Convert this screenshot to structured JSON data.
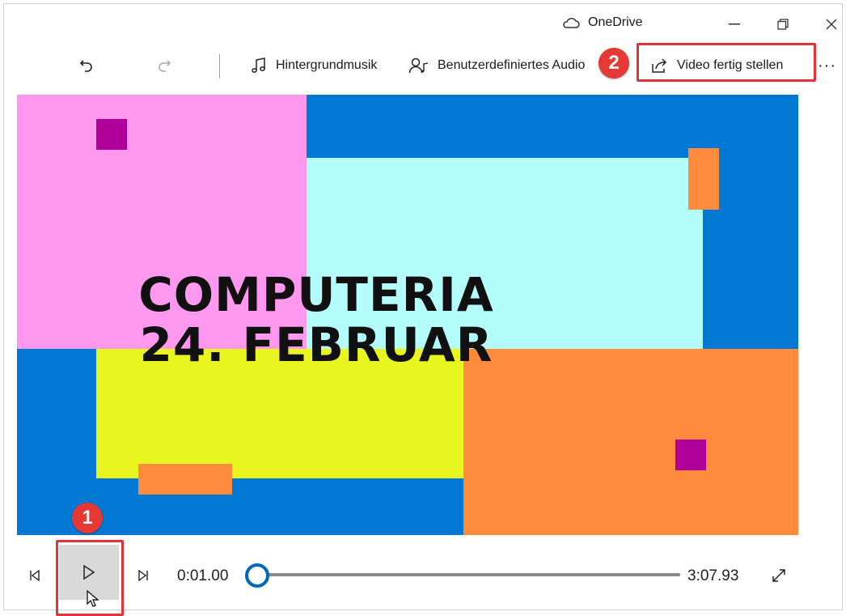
{
  "titlebar": {
    "onedrive_label": "OneDrive",
    "icons": [
      "cloud-icon",
      "minimize-icon",
      "restore-icon",
      "close-icon"
    ]
  },
  "toolbar": {
    "undo_icon": "undo-icon",
    "redo_icon": "redo-icon",
    "music_label": "Hintergrundmusik",
    "audio_label": "Benutzerdefiniertes Audio",
    "finish_label": "Video fertig stellen",
    "more_label": "···"
  },
  "annotations": {
    "badge_play": "1",
    "badge_finish": "2",
    "highlight_color": "#e0333a",
    "badge_color": "#e53935"
  },
  "preview": {
    "title_line1": "COMPUTERIA",
    "title_line2": "24. FEBRUAR",
    "colors": {
      "blue": "#0078d4",
      "pink": "#ff99f0",
      "cyan": "#b3fdfd",
      "yellow": "#e8f51f",
      "orange": "#ff8c3c",
      "purple": "#b0009a"
    }
  },
  "playback": {
    "current_time": "0:01.00",
    "total_time": "3:07.93",
    "progress_fraction": 0.005,
    "accent_color": "#0067c0"
  }
}
